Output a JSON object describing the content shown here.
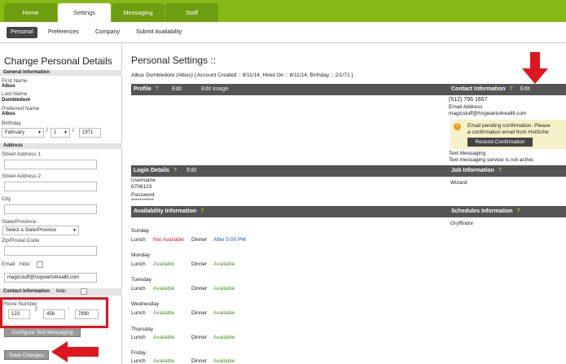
{
  "nav": {
    "tabs": [
      {
        "label": "Home"
      },
      {
        "label": "Settings"
      },
      {
        "label": "Messaging"
      },
      {
        "label": "Staff"
      }
    ],
    "subtabs": [
      {
        "label": "Personal"
      },
      {
        "label": "Preferences"
      },
      {
        "label": "Company"
      },
      {
        "label": "Submit Availability"
      }
    ]
  },
  "left": {
    "title": "Change Personal Details",
    "general_header": "General Information",
    "first_name_label": "First Name",
    "first_name": "Albus",
    "last_name_label": "Last Name",
    "last_name": "Dumbledore",
    "preferred_name_label": "Preferred Name",
    "preferred_name": "Albus",
    "birthday_label": "Birthday",
    "birth_month": "February",
    "birth_day": "1",
    "birth_year": "1971",
    "slash": "/",
    "address_header": "Address",
    "street1_label": "Street Address 1",
    "street2_label": "Street Address 2",
    "city_label": "City",
    "state_label": "State/Province",
    "state_value": "Select a State/Province",
    "zip_label": "Zip/Postal Code",
    "email_label": "Email",
    "hide_label": "hide:",
    "email_value": "magicstuff@hogwarts4reallll.com",
    "contact_header": "Contact Information",
    "phone_label": "Phone Number",
    "phone_area": "123",
    "phone_prefix": "456",
    "phone_line": "7890",
    "paren": ")",
    "dash": "-",
    "configure_button": "Configure Text Messaging",
    "save_button": "Save Changes"
  },
  "main": {
    "title": "Personal Settings ::",
    "meta": "Albus Dumbledore (Albus) [ Account Created :: 8/11/14, Hired On :: 8/11/14, Birthday :: 2/1/71 ]",
    "help_mark": "?",
    "edit_label": "Edit",
    "edit_image_label": "Edit Image",
    "profile_header": "Profile",
    "login_header": "Login Details",
    "username_label": "Username",
    "username": "6706123",
    "password_label": "Password",
    "password": "***********",
    "availability_header": "Availability Information",
    "availability": [
      {
        "day": "Sunday",
        "lunch_label": "Lunch",
        "lunch": "Not Available",
        "dinner_label": "Dinner",
        "dinner": "After 5:00 PM"
      },
      {
        "day": "Monday",
        "lunch_label": "Lunch",
        "lunch": "Available",
        "dinner_label": "Dinner",
        "dinner": "Available"
      },
      {
        "day": "Tuesday",
        "lunch_label": "Lunch",
        "lunch": "Available",
        "dinner_label": "Dinner",
        "dinner": "Available"
      },
      {
        "day": "Wednesday",
        "lunch_label": "Lunch",
        "lunch": "Available",
        "dinner_label": "Dinner",
        "dinner": "Available"
      },
      {
        "day": "Thursday",
        "lunch_label": "Lunch",
        "lunch": "Available",
        "dinner_label": "Dinner",
        "dinner": "Available"
      },
      {
        "day": "Friday",
        "lunch_label": "Lunch",
        "lunch": "Available",
        "dinner_label": "Dinner",
        "dinner": "Available"
      }
    ]
  },
  "right": {
    "contact_header": "Contact Information",
    "phone": "(512)  796  1667",
    "email_label": "Email Address",
    "email": "magicstuff@hogwarts4reallll.com",
    "warning_icon": "!",
    "pending_line1": "Email pending confirmation. Please",
    "pending_line2": "a confirmation email from HotSche",
    "resend_button": "Resend Confirmation",
    "text_label": "Text Messaging",
    "text_value": "Text messaging service is not active.",
    "job_header": "Job Information",
    "job": "Wizard",
    "schedules_header": "Schedules Information",
    "schedule": "Gryffindor"
  },
  "colors": {
    "nav_green": "#86b816",
    "header_dark": "#555555",
    "available_green": "#3d9b12",
    "not_available_red": "#d11818",
    "annotation_red": "#e0161f"
  },
  "icons": {
    "dropdown": "chevron-down-icon",
    "annotation": "red-arrow-icon"
  }
}
